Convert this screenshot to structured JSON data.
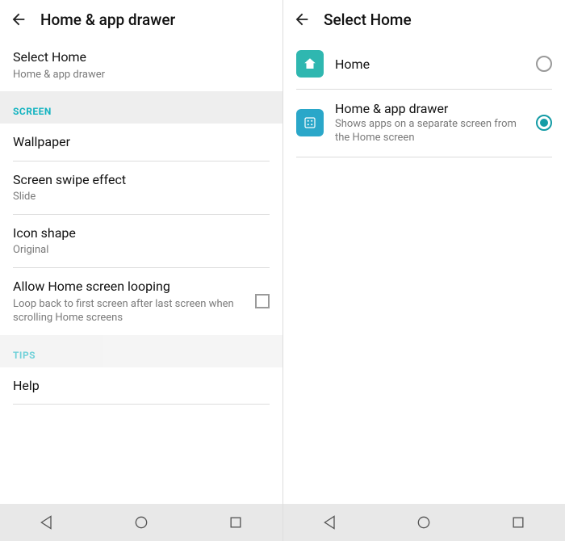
{
  "left": {
    "appbar_title": "Home & app drawer",
    "select_home": {
      "title": "Select Home",
      "subtitle": "Home & app drawer"
    },
    "section_screen": "SCREEN",
    "wallpaper": "Wallpaper",
    "swipe_effect": {
      "title": "Screen swipe effect",
      "value": "Slide"
    },
    "icon_shape": {
      "title": "Icon shape",
      "value": "Original"
    },
    "looping": {
      "title": "Allow Home screen looping",
      "desc": "Loop back to first screen after last screen when scrolling Home screens"
    },
    "section_tips": "TIPS",
    "help": "Help"
  },
  "right": {
    "appbar_title": "Select Home",
    "options": [
      {
        "title": "Home",
        "desc": "",
        "checked": false
      },
      {
        "title": "Home & app drawer",
        "desc": "Shows apps on a separate screen from the Home screen",
        "checked": true
      }
    ]
  }
}
